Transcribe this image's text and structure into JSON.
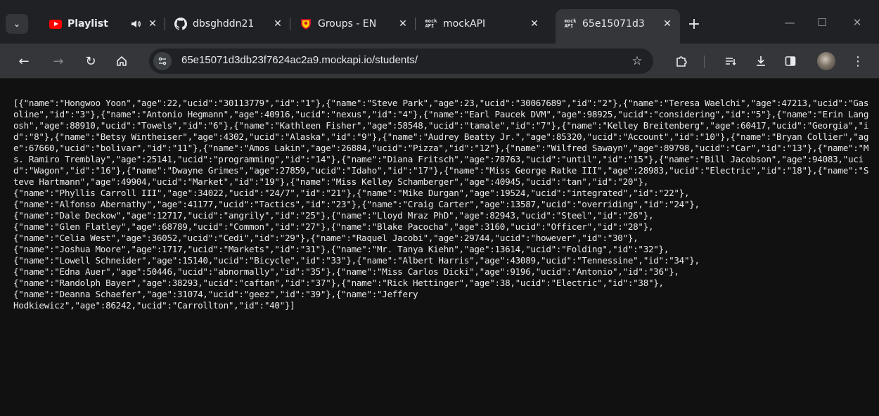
{
  "browser": {
    "tabs": [
      {
        "title": "Playlist",
        "favicon": "youtube-icon",
        "active": false
      },
      {
        "title": "dbsghddn21",
        "favicon": "github-icon",
        "active": false
      },
      {
        "title": "Groups - EN",
        "favicon": "university-shield-icon",
        "active": false
      },
      {
        "title": "mockAPI",
        "favicon": "mockapi-icon",
        "active": false
      },
      {
        "title": "65e15071d3",
        "favicon": "mockapi-icon",
        "active": true
      }
    ],
    "favicon_text": "mock\nAPI",
    "url": "65e15071d3db23f7624ac2a9.mockapi.io/students/"
  },
  "icons": {
    "tab_search": "chevron-down-icon",
    "audio": "speaker-icon",
    "close": "close-icon",
    "new_tab": "plus-icon",
    "minimize": "minimize-icon",
    "maximize": "maximize-icon",
    "window_close": "window-close-icon",
    "back": "back-arrow-icon",
    "forward": "forward-arrow-icon",
    "reload": "reload-icon",
    "home": "home-icon",
    "site_info": "site-info-icon",
    "bookmark": "star-icon",
    "extensions": "puzzle-icon",
    "reading_list": "reading-list-icon",
    "downloads": "download-icon",
    "side_panel": "side-panel-icon",
    "profile": "avatar",
    "menu": "kebab-menu-icon"
  },
  "colors": {
    "youtube": "#ff0000",
    "frame": "#202124",
    "toolbar": "#35363a",
    "page_bg": "#111111",
    "text": "#e8eaed"
  },
  "content": {
    "json_text": "[{\"name\":\"Hongwoo Yoon\",\"age\":22,\"ucid\":\"30113779\",\"id\":\"1\"},{\"name\":\"Steve Park\",\"age\":23,\"ucid\":\"30067689\",\"id\":\"2\"},{\"name\":\"Teresa Waelchi\",\"age\":47213,\"ucid\":\"Gasoline\",\"id\":\"3\"},{\"name\":\"Antonio Hegmann\",\"age\":40916,\"ucid\":\"nexus\",\"id\":\"4\"},{\"name\":\"Earl Paucek DVM\",\"age\":98925,\"ucid\":\"considering\",\"id\":\"5\"},{\"name\":\"Erin Langosh\",\"age\":88910,\"ucid\":\"Towels\",\"id\":\"6\"},{\"name\":\"Kathleen Fisher\",\"age\":58548,\"ucid\":\"tamale\",\"id\":\"7\"},{\"name\":\"Kelley Breitenberg\",\"age\":60417,\"ucid\":\"Georgia\",\"id\":\"8\"},{\"name\":\"Betsy Wintheiser\",\"age\":4302,\"ucid\":\"Alaska\",\"id\":\"9\"},{\"name\":\"Audrey Beatty Jr.\",\"age\":85320,\"ucid\":\"Account\",\"id\":\"10\"},{\"name\":\"Bryan Collier\",\"age\":67660,\"ucid\":\"bolivar\",\"id\":\"11\"},{\"name\":\"Amos Lakin\",\"age\":26884,\"ucid\":\"Pizza\",\"id\":\"12\"},{\"name\":\"Wilfred Sawayn\",\"age\":89798,\"ucid\":\"Car\",\"id\":\"13\"},{\"name\":\"Ms. Ramiro Tremblay\",\"age\":25141,\"ucid\":\"programming\",\"id\":\"14\"},{\"name\":\"Diana Fritsch\",\"age\":78763,\"ucid\":\"until\",\"id\":\"15\"},{\"name\":\"Bill Jacobson\",\"age\":94083,\"ucid\":\"Wagon\",\"id\":\"16\"},{\"name\":\"Dwayne Grimes\",\"age\":27859,\"ucid\":\"Idaho\",\"id\":\"17\"},{\"name\":\"Miss George Ratke III\",\"age\":28983,\"ucid\":\"Electric\",\"id\":\"18\"},{\"name\":\"Steve Hartmann\",\"age\":49904,\"ucid\":\"Market\",\"id\":\"19\"},{\"name\":\"Miss Kelley Schamberger\",\"age\":40945,\"ucid\":\"tan\",\"id\":\"20\"},\n{\"name\":\"Phyllis Carroll III\",\"age\":34022,\"ucid\":\"24/7\",\"id\":\"21\"},{\"name\":\"Mike Durgan\",\"age\":19524,\"ucid\":\"integrated\",\"id\":\"22\"},\n{\"name\":\"Alfonso Abernathy\",\"age\":41177,\"ucid\":\"Tactics\",\"id\":\"23\"},{\"name\":\"Craig Carter\",\"age\":13587,\"ucid\":\"overriding\",\"id\":\"24\"},\n{\"name\":\"Dale Deckow\",\"age\":12717,\"ucid\":\"angrily\",\"id\":\"25\"},{\"name\":\"Lloyd Mraz PhD\",\"age\":82943,\"ucid\":\"Steel\",\"id\":\"26\"},\n{\"name\":\"Glen Flatley\",\"age\":68789,\"ucid\":\"Common\",\"id\":\"27\"},{\"name\":\"Blake Pacocha\",\"age\":3160,\"ucid\":\"Officer\",\"id\":\"28\"},\n{\"name\":\"Celia West\",\"age\":36052,\"ucid\":\"Cedi\",\"id\":\"29\"},{\"name\":\"Raquel Jacobi\",\"age\":29744,\"ucid\":\"however\",\"id\":\"30\"},\n{\"name\":\"Joshua Moore\",\"age\":1717,\"ucid\":\"Markets\",\"id\":\"31\"},{\"name\":\"Mr. Tanya Kiehn\",\"age\":13614,\"ucid\":\"Folding\",\"id\":\"32\"},\n{\"name\":\"Lowell Schneider\",\"age\":15140,\"ucid\":\"Bicycle\",\"id\":\"33\"},{\"name\":\"Albert Harris\",\"age\":43089,\"ucid\":\"Tennessine\",\"id\":\"34\"},\n{\"name\":\"Edna Auer\",\"age\":50446,\"ucid\":\"abnormally\",\"id\":\"35\"},{\"name\":\"Miss Carlos Dicki\",\"age\":9196,\"ucid\":\"Antonio\",\"id\":\"36\"},\n{\"name\":\"Randolph Bayer\",\"age\":38293,\"ucid\":\"caftan\",\"id\":\"37\"},{\"name\":\"Rick Hettinger\",\"age\":38,\"ucid\":\"Electric\",\"id\":\"38\"},\n{\"name\":\"Deanna Schaefer\",\"age\":31074,\"ucid\":\"geez\",\"id\":\"39\"},{\"name\":\"Jeffery\nHodkiewicz\",\"age\":86242,\"ucid\":\"Carrollton\",\"id\":\"40\"}]"
  }
}
